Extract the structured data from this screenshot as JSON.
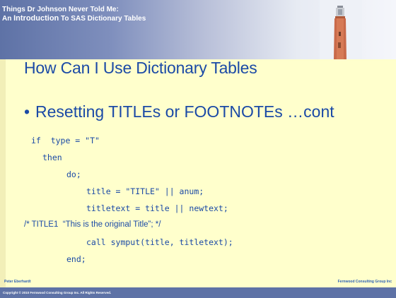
{
  "header": {
    "title_line1": "Things Dr Johnson Never Told Me:",
    "title_line2_prefix": "An ",
    "title_line2_big": "Introduction",
    "title_line2_rest": " To SAS Dictionary Tables"
  },
  "slide": {
    "title": "How Can I Use Dictionary Tables",
    "bullet": "Resetting TITLEs or FOOTNOTEs …cont",
    "code": [
      "if  type = \"T\"",
      "then",
      "do;",
      "title = \"TITLE\" || anum;",
      "titletext = title || newtext;",
      "/* TITLE1  “This is the original Title”; */",
      "call symput(title, titletext);",
      "end;"
    ]
  },
  "footer": {
    "left": "Peter Eberhardt",
    "right": "Fernwood Consulting Group Inc",
    "copyright": "Copyright © 2010 Fernwood Consulting Group Inc. All Rights Reserved."
  },
  "colors": {
    "background": "#ffffcc",
    "header_dark": "#5e72a6",
    "text_blue": "#1b4aa6"
  },
  "icons": {
    "header_image": "lighthouse-icon"
  }
}
